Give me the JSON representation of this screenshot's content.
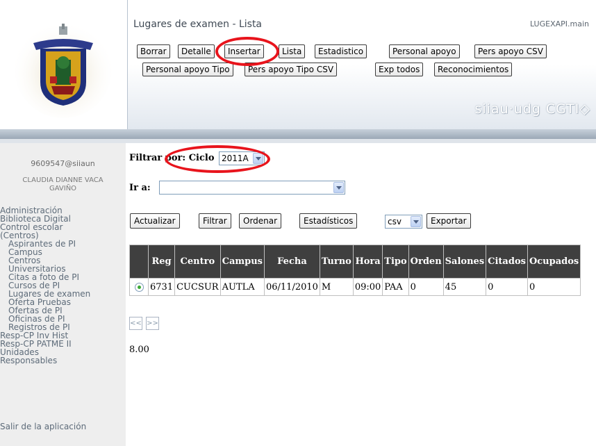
{
  "header": {
    "page_title": "Lugares de examen - Lista",
    "program_id": "LUGEXAPI.main",
    "brand": "siiau·udg  CGTI◇",
    "buttons_row1": [
      "Borrar",
      "Detalle",
      "Insertar",
      "Lista",
      "Estadistico",
      "Personal apoyo",
      "Pers apoyo CSV"
    ],
    "buttons_row2": [
      "Personal apoyo Tipo",
      "Pers apoyo Tipo CSV",
      "Exp todos",
      "Reconocimientos"
    ]
  },
  "sidebar": {
    "user_id": "9609547@siiaun",
    "user_name_line1": "CLAUDIA DIANNE VACA",
    "user_name_line2": "GAVIÑO",
    "menu": [
      {
        "label": "Administración",
        "level": "top"
      },
      {
        "label": "Biblioteca Digital",
        "level": "top"
      },
      {
        "label": "Control escolar",
        "level": "top"
      },
      {
        "label": "(Centros)",
        "level": "top"
      },
      {
        "label": "Aspirantes de PI",
        "level": "sub"
      },
      {
        "label": "Campus",
        "level": "sub"
      },
      {
        "label": "Centros",
        "level": "sub"
      },
      {
        "label": "Universitarios",
        "level": "sub"
      },
      {
        "label": "Citas a foto de PI",
        "level": "sub"
      },
      {
        "label": "Cursos de PI",
        "level": "sub"
      },
      {
        "label": "Lugares de examen",
        "level": "sub"
      },
      {
        "label": "Oferta Pruebas",
        "level": "sub"
      },
      {
        "label": "Ofertas de PI",
        "level": "sub"
      },
      {
        "label": "Oficinas de PI",
        "level": "sub"
      },
      {
        "label": "Registros de PI",
        "level": "sub"
      },
      {
        "label": "Resp-CP Inv Hist",
        "level": "top"
      },
      {
        "label": "Resp-CP PATME II",
        "level": "top"
      },
      {
        "label": "Unidades",
        "level": "top"
      },
      {
        "label": "Responsables",
        "level": "top"
      }
    ],
    "logout": "Salir de la aplicación"
  },
  "main": {
    "filter_label": "Filtrar por: Ciclo",
    "ciclo_value": "2011A",
    "goto_label": "Ir a:",
    "goto_value": "",
    "actions": [
      "Actualizar",
      "Filtrar",
      "Ordenar",
      "Estadísticos"
    ],
    "export_format": "csv",
    "export_label": "Exportar",
    "table": {
      "columns": [
        "",
        "Reg",
        "Centro",
        "Campus",
        "Fecha",
        "Turno",
        "Hora",
        "Tipo",
        "Orden",
        "Salones",
        "Citados",
        "Ocupados"
      ],
      "rows": [
        [
          "",
          "6731",
          "CUCSUR",
          "AUTLA",
          "06/11/2010",
          "M",
          "09:00",
          "PAA",
          "0",
          "45",
          "0",
          "0"
        ]
      ]
    },
    "pager_prev": "<<",
    "pager_next": ">>",
    "result_value": "8.00"
  },
  "colors": {
    "header_dark": "#3f3f3f",
    "annotation_red": "#e8141c",
    "menu_text": "#5d6b79"
  }
}
